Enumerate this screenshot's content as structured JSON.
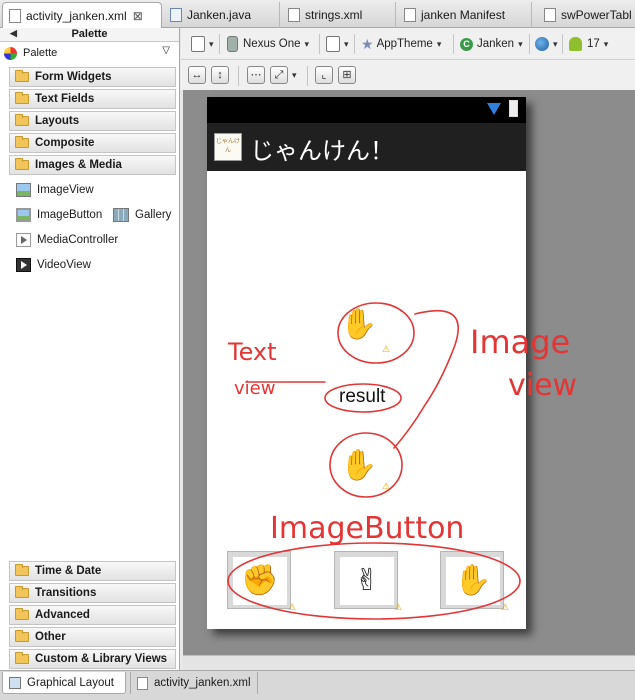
{
  "tabs": [
    {
      "label": "activity_janken.xml",
      "active": true,
      "close": "⊠"
    },
    {
      "label": "Janken.java",
      "active": false
    },
    {
      "label": "strings.xml",
      "active": false
    },
    {
      "label": "janken Manifest",
      "active": false
    },
    {
      "label": "swPowerTabl",
      "active": false
    }
  ],
  "palette": {
    "title": "Palette",
    "selector": "Palette",
    "categories_top": [
      "Form Widgets",
      "Text Fields",
      "Layouts",
      "Composite",
      "Images & Media"
    ],
    "images_media_items": [
      "ImageView",
      "ImageButton",
      "Gallery",
      "MediaController",
      "VideoView"
    ],
    "categories_bottom": [
      "Time & Date",
      "Transitions",
      "Advanced",
      "Other",
      "Custom & Library Views"
    ]
  },
  "toolbar": {
    "device": "Nexus One",
    "theme": "AppTheme",
    "activity": "Janken",
    "api_level": "17"
  },
  "screen": {
    "app_title": "じゃんけん！",
    "app_icon_text": "じゃんけん",
    "result_text": "result",
    "hand_glyph": "✋",
    "buttons": [
      "✊",
      "✌",
      "✋"
    ]
  },
  "annotations": {
    "textview": [
      "Text",
      "view"
    ],
    "imageview": [
      "Image",
      "view"
    ],
    "imagebutton": "ImageButton",
    "color": "#e23636"
  },
  "bottom_tabs": [
    "Graphical Layout",
    "activity_janken.xml"
  ]
}
